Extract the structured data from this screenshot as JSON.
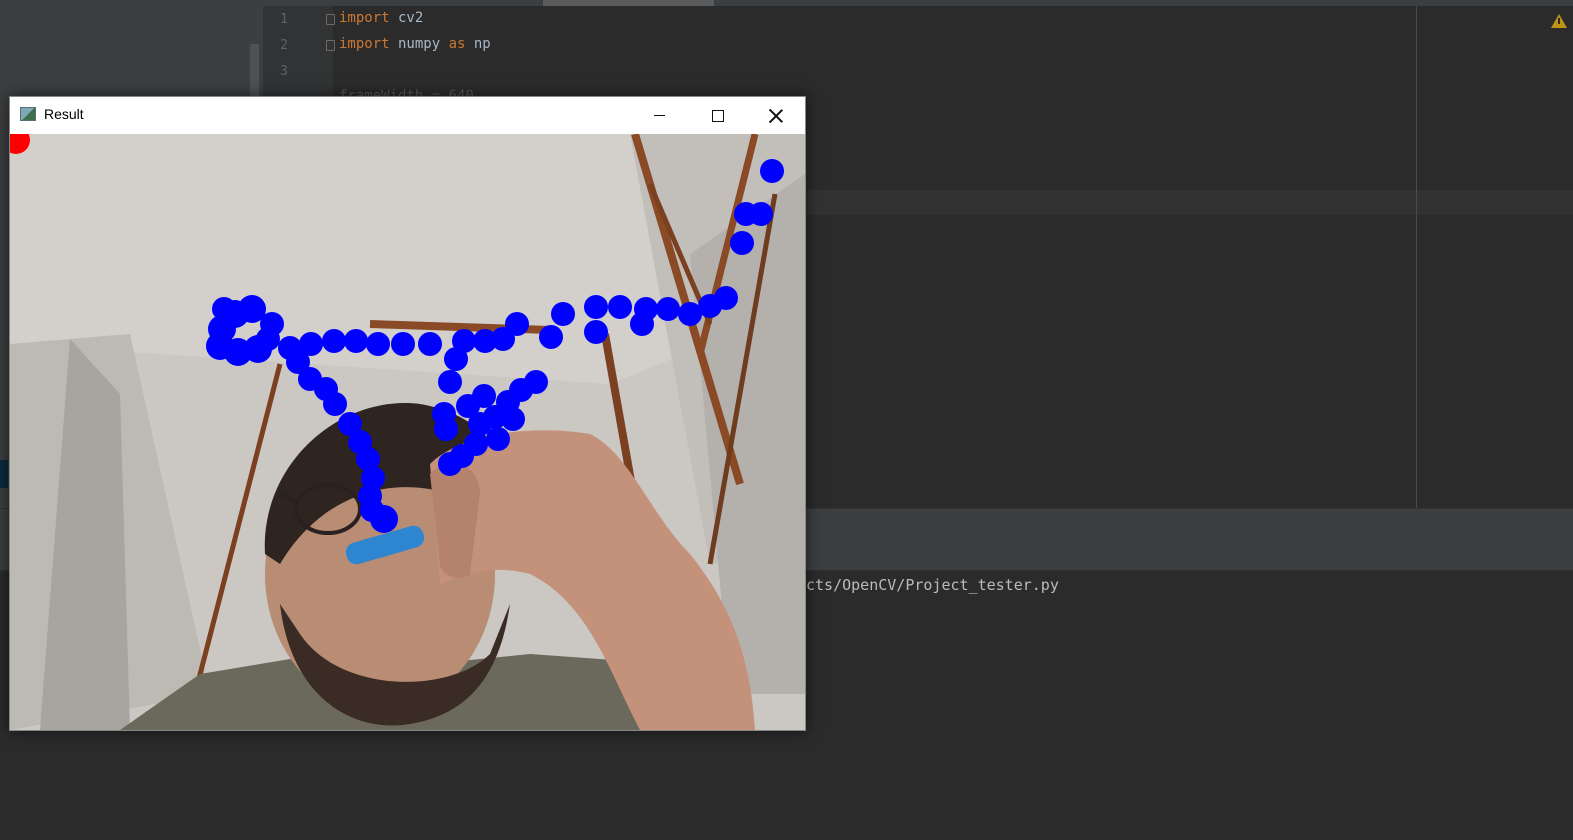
{
  "editor": {
    "line_numbers": [
      "1",
      "2",
      "3"
    ],
    "lines": [
      {
        "kw": "import",
        "rest": " cv2"
      },
      {
        "kw": "import",
        "rest": " numpy ",
        "kw2": "as",
        "rest2": " np"
      }
    ],
    "faded_line": "frameWidth = 640"
  },
  "console": {
    "run_path_fragment": "cts/OpenCV/Project_tester.py"
  },
  "result_window": {
    "title": "Result",
    "buttons": {
      "minimize": "minimize",
      "maximize": "maximize",
      "close": "close"
    }
  },
  "colors": {
    "drawn_points": "#0000ff",
    "marker_dot": "#ff0000",
    "ide_background": "#2b2b2b",
    "keyword": "#cc7832"
  },
  "icons": [
    "warning-icon",
    "app-icon",
    "minimize-icon",
    "maximize-icon",
    "close-icon"
  ]
}
